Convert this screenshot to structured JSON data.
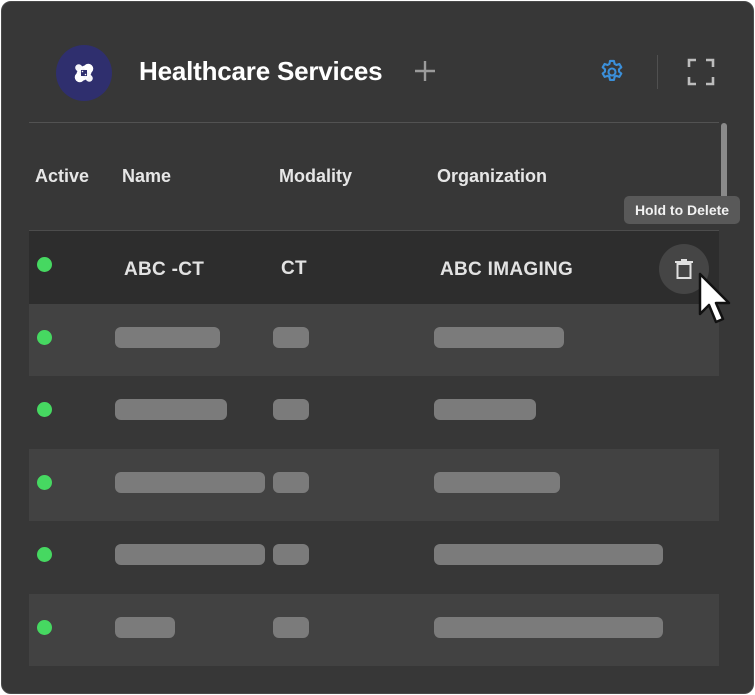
{
  "header": {
    "title": "Healthcare Services",
    "logo_icon": "bandage-icon",
    "add_icon": "plus-icon",
    "settings_icon": "gear-icon",
    "fullscreen_icon": "expand-icon"
  },
  "table": {
    "columns": [
      "Active",
      "Name",
      "Modality",
      "Organization"
    ],
    "rows": [
      {
        "active": true,
        "name": "ABC -CT",
        "modality": "CT",
        "organization": "ABC IMAGING"
      },
      {
        "active": true,
        "redacted": true
      },
      {
        "active": true,
        "redacted": true
      },
      {
        "active": true,
        "redacted": true
      },
      {
        "active": true,
        "redacted": true
      },
      {
        "active": true,
        "redacted": true
      }
    ]
  },
  "tooltip": {
    "text": "Hold to Delete"
  },
  "colors": {
    "panel_bg": "#373737",
    "active_dot": "#46d861",
    "accent": "#3b8fd9",
    "logo_bg": "#2f2f6e"
  }
}
